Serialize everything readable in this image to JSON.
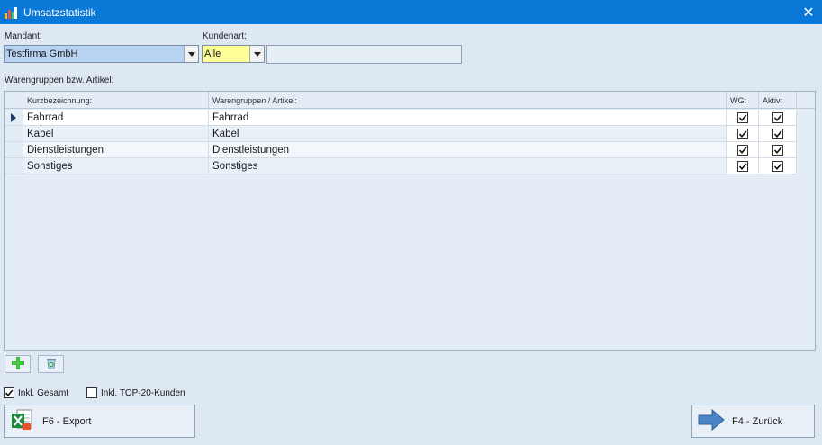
{
  "window": {
    "title": "Umsatzstatistik",
    "close_glyph": "✕"
  },
  "filters": {
    "mandant_label": "Mandant:",
    "mandant_value": "Testfirma GmbH",
    "kundenart_label": "Kundenart:",
    "kundenart_value": "Alle",
    "kundenart_text": ""
  },
  "grid": {
    "section_label": "Warengruppen bzw. Artikel:",
    "columns": {
      "kurz": "Kurzbezeichnung:",
      "warengruppen": "Warengruppen / Artikel:",
      "wg": "WG:",
      "aktiv": "Aktiv:"
    },
    "rows": [
      {
        "kurz": "Fahrrad",
        "warengruppen": "Fahrrad",
        "wg": true,
        "aktiv": true
      },
      {
        "kurz": "Kabel",
        "warengruppen": "Kabel",
        "wg": true,
        "aktiv": true
      },
      {
        "kurz": "Dienstleistungen",
        "warengruppen": "Dienstleistungen",
        "wg": true,
        "aktiv": true
      },
      {
        "kurz": "Sonstiges",
        "warengruppen": "Sonstiges",
        "wg": true,
        "aktiv": true
      }
    ]
  },
  "options": {
    "inkl_gesamt_label": "Inkl. Gesamt",
    "inkl_gesamt_checked": true,
    "inkl_top20_label": "Inkl. TOP-20-Kunden",
    "inkl_top20_checked": false
  },
  "buttons": {
    "export_label": "F6 - Export",
    "back_label": "F4 - Zurück"
  },
  "icons": {
    "add": "plus-icon",
    "delete": "recycle-bin-icon",
    "export": "excel-icon",
    "back": "arrow-right-icon"
  },
  "colors": {
    "titlebar": "#0a78d7",
    "mandant_highlight": "#b8d2f2",
    "kundenart_highlight": "#ffff99"
  }
}
